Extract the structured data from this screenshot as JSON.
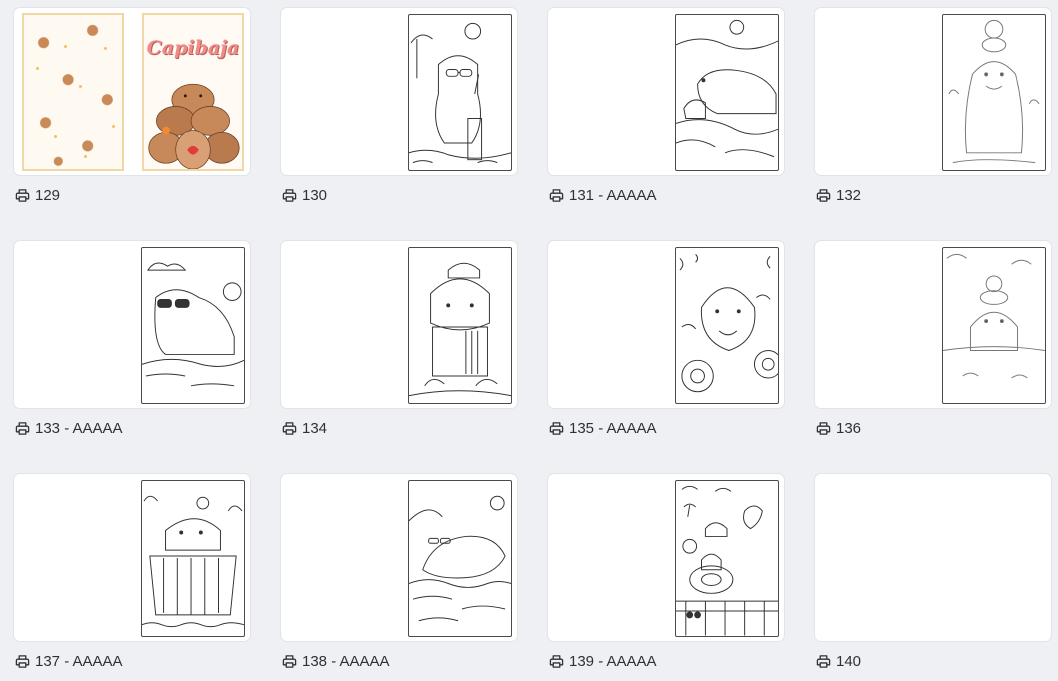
{
  "icons": {
    "print": "printer-icon"
  },
  "colors": {
    "background": "#eff0f4",
    "card": "#ffffff",
    "text": "#2f3138"
  },
  "cover": {
    "title": "Capibaja"
  },
  "pages": [
    {
      "label": "129",
      "art": "cover"
    },
    {
      "label": "130",
      "art": "sunglasses-drink"
    },
    {
      "label": "131 - AAAAA",
      "art": "river-pair"
    },
    {
      "label": "132",
      "art": "orange-head"
    },
    {
      "label": "133 - AAAAA",
      "art": "sunglasses-lying"
    },
    {
      "label": "134",
      "art": "cap-jacket"
    },
    {
      "label": "135 - AAAAA",
      "art": "sunflowers"
    },
    {
      "label": "136",
      "art": "water-orange"
    },
    {
      "label": "137 - AAAAA",
      "art": "hot-tub"
    },
    {
      "label": "138 - AAAAA",
      "art": "swimming"
    },
    {
      "label": "139 - AAAAA",
      "art": "pool-party"
    },
    {
      "label": "140",
      "art": "blank"
    }
  ]
}
